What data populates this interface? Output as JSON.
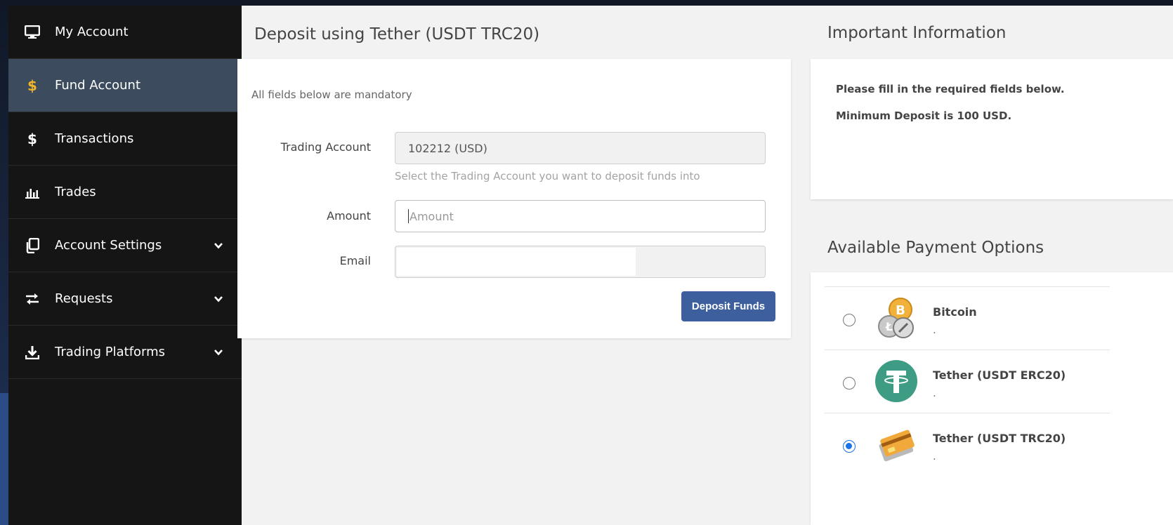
{
  "sidebar": {
    "items": [
      {
        "label": "My Account",
        "icon": "monitor-icon",
        "active": false,
        "expandable": false
      },
      {
        "label": "Fund Account",
        "icon": "dollar-icon",
        "active": true,
        "expandable": false
      },
      {
        "label": "Transactions",
        "icon": "dollar-icon",
        "active": false,
        "expandable": false
      },
      {
        "label": "Trades",
        "icon": "bar-chart-icon",
        "active": false,
        "expandable": false
      },
      {
        "label": "Account Settings",
        "icon": "copy-icon",
        "active": false,
        "expandable": true
      },
      {
        "label": "Requests",
        "icon": "exchange-icon",
        "active": false,
        "expandable": true
      },
      {
        "label": "Trading Platforms",
        "icon": "download-icon",
        "active": false,
        "expandable": true
      }
    ]
  },
  "deposit": {
    "title": "Deposit using Tether (USDT TRC20)",
    "mandatory_note": "All fields below are mandatory",
    "trading_account_label": "Trading Account",
    "trading_account_value": "102212 (USD)",
    "trading_account_help": "Select the Trading Account you want to deposit funds into",
    "amount_label": "Amount",
    "amount_placeholder": "Amount",
    "email_label": "Email",
    "email_value": "",
    "submit_label": "Deposit Funds"
  },
  "info": {
    "title": "Important Information",
    "lines": [
      "Please fill in the required fields below.",
      "Minimum Deposit is 100 USD."
    ]
  },
  "payment": {
    "title": "Available Payment Options",
    "options": [
      {
        "name": "Bitcoin",
        "sub": ".",
        "icon": "bitcoin-coins-icon",
        "selected": false
      },
      {
        "name": "Tether (USDT ERC20)",
        "sub": ".",
        "icon": "tether-icon",
        "selected": false
      },
      {
        "name": "Tether (USDT TRC20)",
        "sub": ".",
        "icon": "credit-card-icon",
        "selected": true
      }
    ]
  },
  "colors": {
    "sidebar_bg": "#151515",
    "sidebar_active": "#3c4c5e",
    "accent_dollar": "#f0b429",
    "button": "#3d5f9e",
    "tether_green": "#3d9c83",
    "radio_selected": "#1a73e8"
  }
}
